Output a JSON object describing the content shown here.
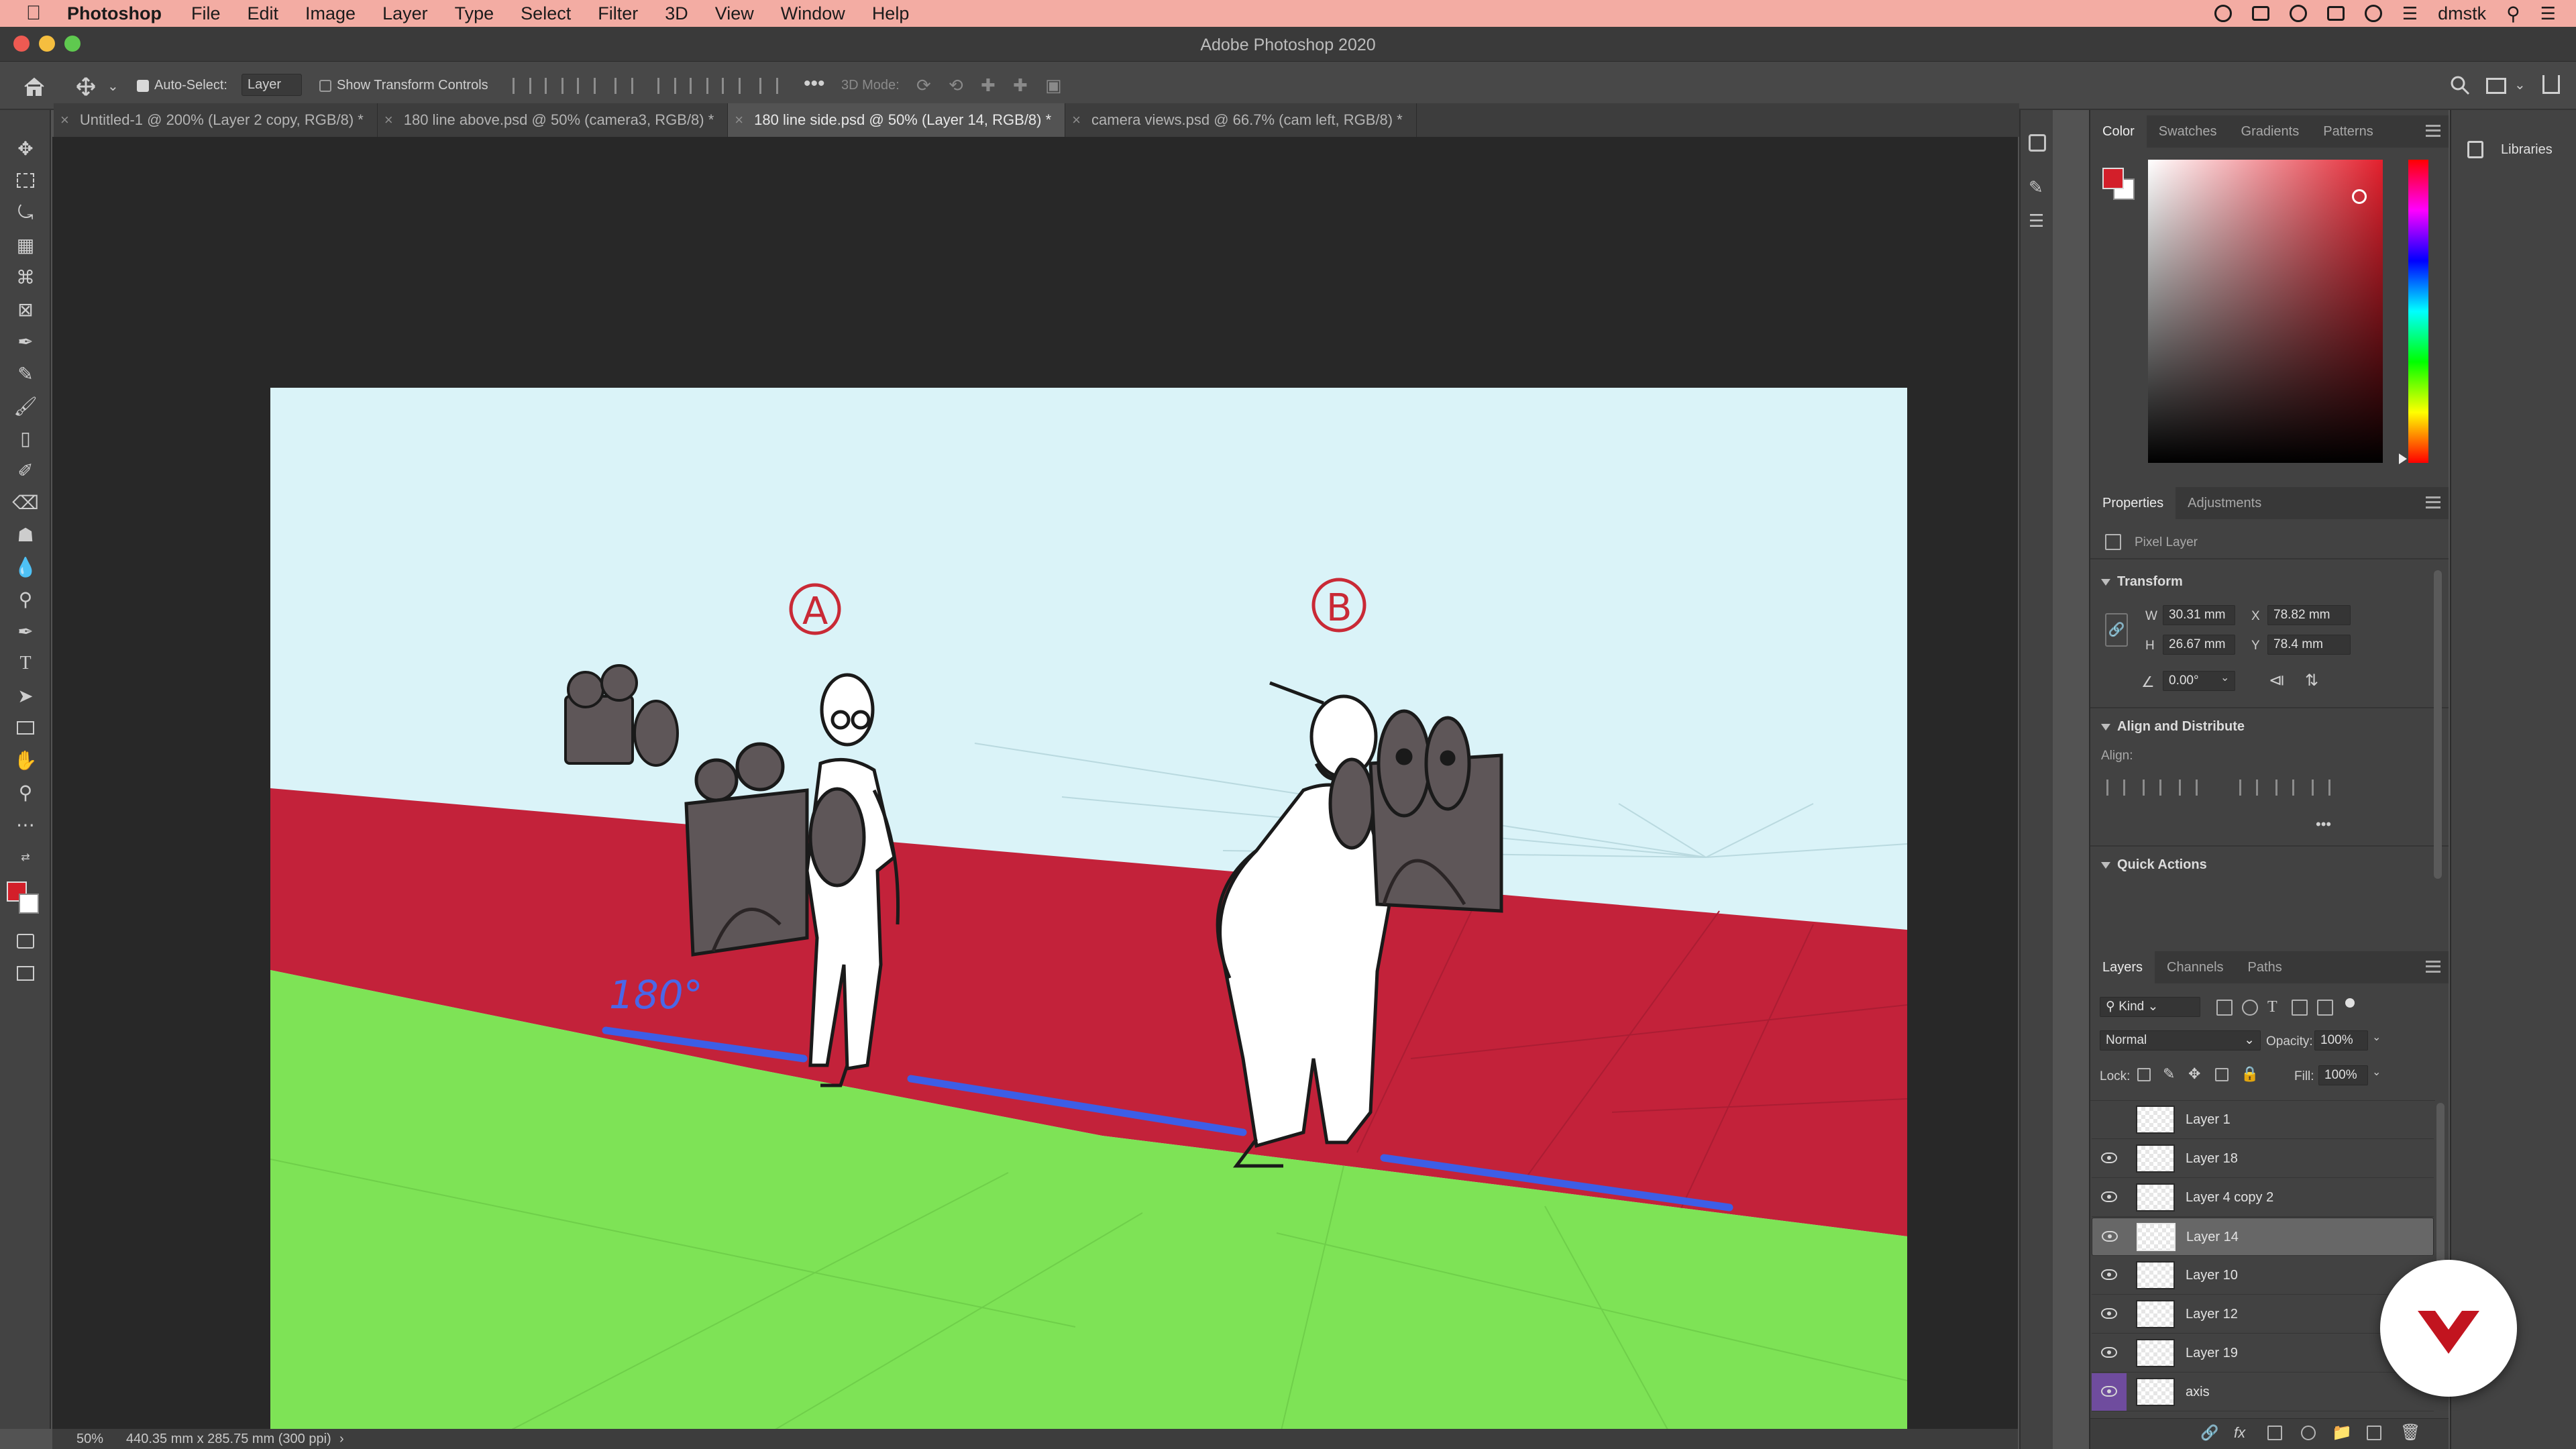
{
  "menubar": {
    "app_name": "Photoshop",
    "items": [
      "File",
      "Edit",
      "Image",
      "Layer",
      "Type",
      "Select",
      "Filter",
      "3D",
      "View",
      "Window",
      "Help"
    ],
    "user": "dmstk"
  },
  "window": {
    "title": "Adobe Photoshop 2020"
  },
  "options_bar": {
    "auto_select_label": "Auto-Select:",
    "auto_select_value": "Layer",
    "show_transform_label": "Show Transform Controls",
    "mode_3d_label": "3D Mode:"
  },
  "tabs": [
    {
      "label": "Untitled-1 @ 200% (Layer 2 copy, RGB/8) *",
      "active": false
    },
    {
      "label": "180 line above.psd @ 50% (camera3, RGB/8) *",
      "active": false
    },
    {
      "label": "180 line side.psd @ 50% (Layer 14, RGB/8) *",
      "active": true
    },
    {
      "label": "camera views.psd @ 66.7% (cam left, RGB/8) *",
      "active": false
    }
  ],
  "canvas": {
    "label_a": "A",
    "label_b": "B",
    "angle_note": "180°",
    "colors": {
      "sky": "#daf3f8",
      "wall": "#c3223a",
      "floor": "#7ee356",
      "line": "#3d5ee6",
      "camera": "#5e5658",
      "ink": "#1a1a1a",
      "mark": "#c92a36"
    }
  },
  "status_bar": {
    "zoom": "50%",
    "doc_info": "440.35 mm x 285.75 mm (300 ppi)"
  },
  "color_panel": {
    "tabs": [
      "Color",
      "Swatches",
      "Gradients",
      "Patterns"
    ],
    "foreground": "#d31f2a",
    "background": "#ffffff"
  },
  "properties_panel": {
    "tabs": [
      "Properties",
      "Adjustments"
    ],
    "kind": "Pixel Layer",
    "transform_label": "Transform",
    "w_label": "W",
    "w": "30.31 mm",
    "x_label": "X",
    "x": "78.82 mm",
    "h_label": "H",
    "h": "26.67 mm",
    "y_label": "Y",
    "y": "78.4 mm",
    "angle": "0.00°",
    "align_section": "Align and Distribute",
    "align_label": "Align:",
    "quick_actions": "Quick Actions"
  },
  "layers_panel": {
    "tabs": [
      "Layers",
      "Channels",
      "Paths"
    ],
    "filter_kind": "Kind",
    "blend_mode": "Normal",
    "opacity_label": "Opacity:",
    "opacity": "100%",
    "lock_label": "Lock:",
    "fill_label": "Fill:",
    "fill": "100%",
    "layers": [
      {
        "name": "Layer 1",
        "visible": false,
        "selected": false
      },
      {
        "name": "Layer 18",
        "visible": true,
        "selected": false
      },
      {
        "name": "Layer 4 copy 2",
        "visible": true,
        "selected": false
      },
      {
        "name": "Layer 14",
        "visible": true,
        "selected": true
      },
      {
        "name": "Layer 10",
        "visible": true,
        "selected": false
      },
      {
        "name": "Layer 12",
        "visible": true,
        "selected": false
      },
      {
        "name": "Layer 19",
        "visible": true,
        "selected": false
      },
      {
        "name": "axis",
        "visible": true,
        "selected": false
      }
    ]
  },
  "libraries": {
    "label": "Libraries"
  },
  "icons": [
    "apple-icon",
    "home-icon",
    "move-tool-icon",
    "marquee-icon",
    "lasso-icon",
    "crop-icon",
    "eyedropper-icon",
    "brush-icon",
    "eraser-icon",
    "type-icon",
    "hand-icon",
    "zoom-icon",
    "search-icon",
    "eye-icon",
    "link-icon",
    "folder-icon",
    "trash-icon"
  ]
}
